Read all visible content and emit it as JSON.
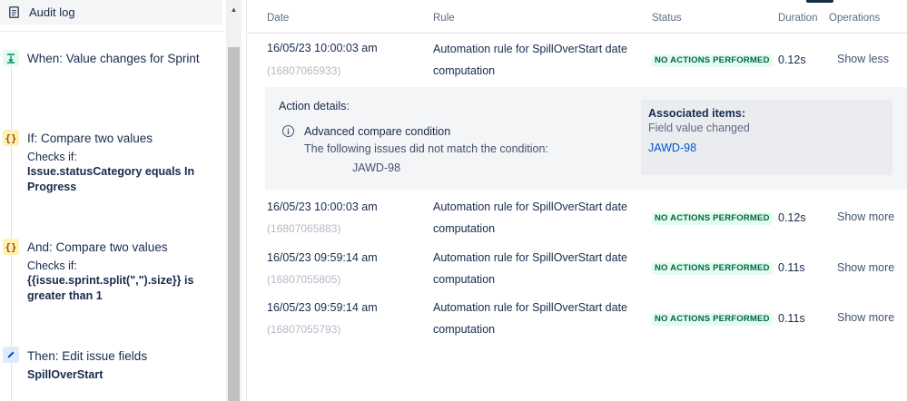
{
  "sidebar": {
    "audit_log_label": "Audit log",
    "components": [
      {
        "type": "trigger",
        "icon": "trigger-icon",
        "title": "When: Value changes for Sprint"
      },
      {
        "type": "condition",
        "icon": "braces-icon",
        "title": "If: Compare two values",
        "checks_label": "Checks if:",
        "expression": "Issue.statusCategory equals In Progress"
      },
      {
        "type": "condition",
        "icon": "braces-icon",
        "title": "And: Compare two values",
        "checks_label": "Checks if:",
        "expression": "{{issue.sprint.split(\",\").size}} is greater than 1"
      },
      {
        "type": "action",
        "icon": "pencil-icon",
        "title": "Then: Edit issue fields",
        "field": "SpillOverStart"
      }
    ]
  },
  "table": {
    "headers": {
      "date": "Date",
      "rule": "Rule",
      "status": "Status",
      "duration": "Duration",
      "operations": "Operations"
    },
    "rows": [
      {
        "date": "16/05/23 10:00:03 am",
        "id": "(16807065933)",
        "rule": "Automation rule for SpillOverStart date computation",
        "status": "NO ACTIONS PERFORMED",
        "duration": "0.12s",
        "operation": "Show less"
      },
      {
        "date": "16/05/23 10:00:03 am",
        "id": "(16807065883)",
        "rule": "Automation rule for SpillOverStart date computation",
        "status": "NO ACTIONS PERFORMED",
        "duration": "0.12s",
        "operation": "Show more"
      },
      {
        "date": "16/05/23 09:59:14 am",
        "id": "(16807055805)",
        "rule": "Automation rule for SpillOverStart date computation",
        "status": "NO ACTIONS PERFORMED",
        "duration": "0.11s",
        "operation": "Show more"
      },
      {
        "date": "16/05/23 09:59:14 am",
        "id": "(16807055793)",
        "rule": "Automation rule for SpillOverStart date computation",
        "status": "NO ACTIONS PERFORMED",
        "duration": "0.11s",
        "operation": "Show more"
      }
    ],
    "details": {
      "title": "Action details:",
      "condition_name": "Advanced compare condition",
      "message": "The following issues did not match the condition:",
      "issue_key": "JAWD-98",
      "associated": {
        "title": "Associated items:",
        "subtitle": "Field value changed",
        "link": "JAWD-98"
      }
    }
  },
  "colors": {
    "lozenge_bg": "#e3fcef",
    "lozenge_text": "#006644",
    "link": "#0052cc",
    "details_bg": "#f4f5f7"
  }
}
